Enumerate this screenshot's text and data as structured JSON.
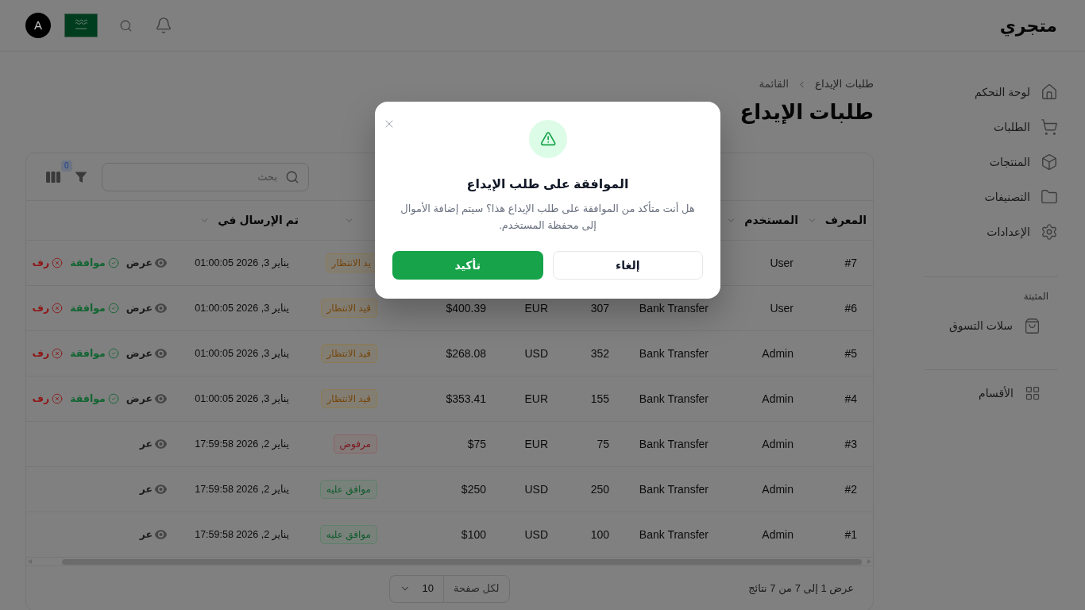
{
  "top_bar": {
    "logo": "متجري",
    "avatar_initial": "A"
  },
  "sidebar": {
    "items": [
      {
        "label": "لوحة التحكم"
      },
      {
        "label": "الطلبات"
      },
      {
        "label": "المنتجات"
      },
      {
        "label": "التصنيفات"
      },
      {
        "label": "الإعدادات"
      }
    ],
    "pinned": {
      "heading": "المثبتة",
      "items": [
        {
          "label": "سلات التسوق"
        }
      ]
    },
    "sections": [
      {
        "label": "الأقسام"
      }
    ]
  },
  "breadcrumb": [
    "طلبات الإيداع",
    "القائمة"
  ],
  "page_title": "طلبات الإيداع",
  "toolbar": {
    "search": {
      "placeholder": "بحث"
    },
    "filter_count": "0"
  },
  "table": {
    "columns": [
      {
        "label": "المعرف",
        "sortable": true
      },
      {
        "label": "المستخدم",
        "sortable": true
      },
      {},
      {},
      {},
      {},
      {
        "sortable": true
      },
      {
        "label": "تم الإرسال في",
        "sortable": true
      },
      {}
    ],
    "rows": [
      {
        "id": "#7",
        "user": "User",
        "column_7": {
          "text": "يد الانتظار",
          "kind": "pending"
        },
        "submitted_at": "يناير 3, 2026 01:00:05",
        "actions": [
          {
            "kind": "view",
            "label": "عرض"
          },
          {
            "kind": "approve",
            "label": "موافقة"
          },
          {
            "kind": "reject",
            "label": "رف"
          }
        ]
      },
      {
        "id": "#6",
        "user": "User",
        "column_3": "Bank Transfer",
        "column_4": "307",
        "column_5": "EUR",
        "column_6": "$400.39",
        "column_7": {
          "text": "قيد الانتظار",
          "kind": "pending"
        },
        "submitted_at": "يناير 3, 2026 01:00:05",
        "actions": [
          {
            "kind": "view",
            "label": "عرض"
          },
          {
            "kind": "approve",
            "label": "موافقة"
          },
          {
            "kind": "reject",
            "label": "رف"
          }
        ]
      },
      {
        "id": "#5",
        "user": "Admin",
        "column_3": "Bank Transfer",
        "column_4": "352",
        "column_5": "USD",
        "column_6": "$268.08",
        "column_7": {
          "text": "قيد الانتظار",
          "kind": "pending"
        },
        "submitted_at": "يناير 3, 2026 01:00:05",
        "actions": [
          {
            "kind": "view",
            "label": "عرض"
          },
          {
            "kind": "approve",
            "label": "موافقة"
          },
          {
            "kind": "reject",
            "label": "رف"
          }
        ]
      },
      {
        "id": "#4",
        "user": "Admin",
        "column_3": "Bank Transfer",
        "column_4": "155",
        "column_5": "EUR",
        "column_6": "$353.41",
        "column_7": {
          "text": "قيد الانتظار",
          "kind": "pending"
        },
        "submitted_at": "يناير 3, 2026 01:00:05",
        "actions": [
          {
            "kind": "view",
            "label": "عرض"
          },
          {
            "kind": "approve",
            "label": "موافقة"
          },
          {
            "kind": "reject",
            "label": "رف"
          }
        ]
      },
      {
        "id": "#3",
        "user": "Admin",
        "column_3": "Bank Transfer",
        "column_4": "75",
        "column_5": "EUR",
        "column_6": "$75",
        "column_7": {
          "text": "مرفوض",
          "kind": "rejected"
        },
        "submitted_at": "يناير 2, 2026 17:59:58",
        "actions": [
          {
            "kind": "view",
            "label": "عر"
          }
        ]
      },
      {
        "id": "#2",
        "user": "Admin",
        "column_3": "Bank Transfer",
        "column_4": "250",
        "column_5": "USD",
        "column_6": "$250",
        "column_7": {
          "text": "موافق عليه",
          "kind": "approved"
        },
        "submitted_at": "يناير 2, 2026 17:59:58",
        "actions": [
          {
            "kind": "view",
            "label": "عر"
          }
        ]
      },
      {
        "id": "#1",
        "user": "Admin",
        "column_3": "Bank Transfer",
        "column_4": "100",
        "column_5": "USD",
        "column_6": "$100",
        "column_7": {
          "text": "موافق عليه",
          "kind": "approved"
        },
        "submitted_at": "يناير 2, 2026 17:59:58",
        "actions": [
          {
            "kind": "view",
            "label": "عر"
          }
        ]
      }
    ]
  },
  "pagination": {
    "summary": "عرض 1 إلى 7 من 7 نتائج",
    "per_page_label": "لكل صفحة",
    "per_page": "10"
  },
  "dialog": {
    "title": "الموافقة على طلب الإيداع",
    "message": "هل أنت متأكد من الموافقة على طلب الإيداع هذا؟ سيتم إضافة الأموال إلى محفظة المستخدم.",
    "buttons": [
      {
        "label": "إلغاء",
        "kind": "secondary"
      },
      {
        "label": "تأكيد",
        "kind": "primary"
      }
    ]
  }
}
